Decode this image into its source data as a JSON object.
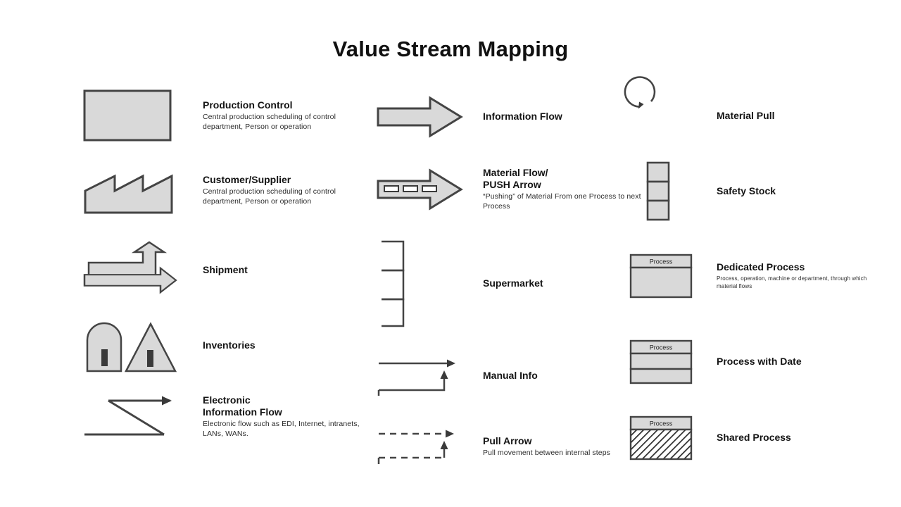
{
  "page": {
    "title": "Value Stream Mapping",
    "background_color": "#ffffff",
    "shape_fill_color": "#d9d9d9",
    "shape_stroke_color": "#444444",
    "text_color": "#141414"
  },
  "columns": [
    {
      "id": "column-left",
      "items": [
        {
          "icon": "production-control-box-icon",
          "title": "Production Control",
          "desc": "Central production scheduling of control department, Person or operation"
        },
        {
          "icon": "customer-supplier-factory-icon",
          "title": "Customer/Supplier",
          "desc": "Central production scheduling of control department, Person or operation"
        },
        {
          "icon": "shipment-arrow-icon",
          "title": "Shipment",
          "desc": ""
        },
        {
          "icon": "inventories-icon",
          "title": "Inventories",
          "desc": ""
        },
        {
          "icon": "electronic-information-flow-icon",
          "title": "Electronic Information Flow",
          "desc": "Electronic flow such as EDI, Internet, intranets, LANs, WANs."
        }
      ]
    },
    {
      "id": "column-middle",
      "items": [
        {
          "icon": "information-flow-arrow-icon",
          "title": "Information Flow",
          "desc": ""
        },
        {
          "icon": "push-arrow-icon",
          "title": "Material Flow/ PUSH Arrow",
          "desc": "“Pushing” of Material From one Process to next Process"
        },
        {
          "icon": "supermarket-icon",
          "title": "Supermarket",
          "desc": ""
        },
        {
          "icon": "manual-info-arrow-icon",
          "title": "Manual Info",
          "desc": ""
        },
        {
          "icon": "pull-arrow-icon",
          "title": "Pull Arrow",
          "desc": "Pull movement between internal steps"
        }
      ]
    },
    {
      "id": "column-right",
      "items": [
        {
          "icon": "material-pull-circle-icon",
          "title": "Material Pull",
          "desc": ""
        },
        {
          "icon": "safety-stock-icon",
          "title": "Safety Stock",
          "desc": ""
        },
        {
          "icon": "dedicated-process-icon",
          "title": "Dedicated Process",
          "desc": "Process, operation, machine or department, through which material flows",
          "box_label": "Process"
        },
        {
          "icon": "process-with-date-icon",
          "title": "Process with Date",
          "desc": "",
          "box_label": "Process"
        },
        {
          "icon": "shared-process-icon",
          "title": "Shared Process",
          "desc": "",
          "box_label": "Process"
        }
      ]
    }
  ],
  "labels": {
    "material_flow_line1": "Material Flow/",
    "material_flow_line2": "PUSH Arrow",
    "electronic_line1": "Electronic",
    "electronic_line2": "Information Flow"
  }
}
